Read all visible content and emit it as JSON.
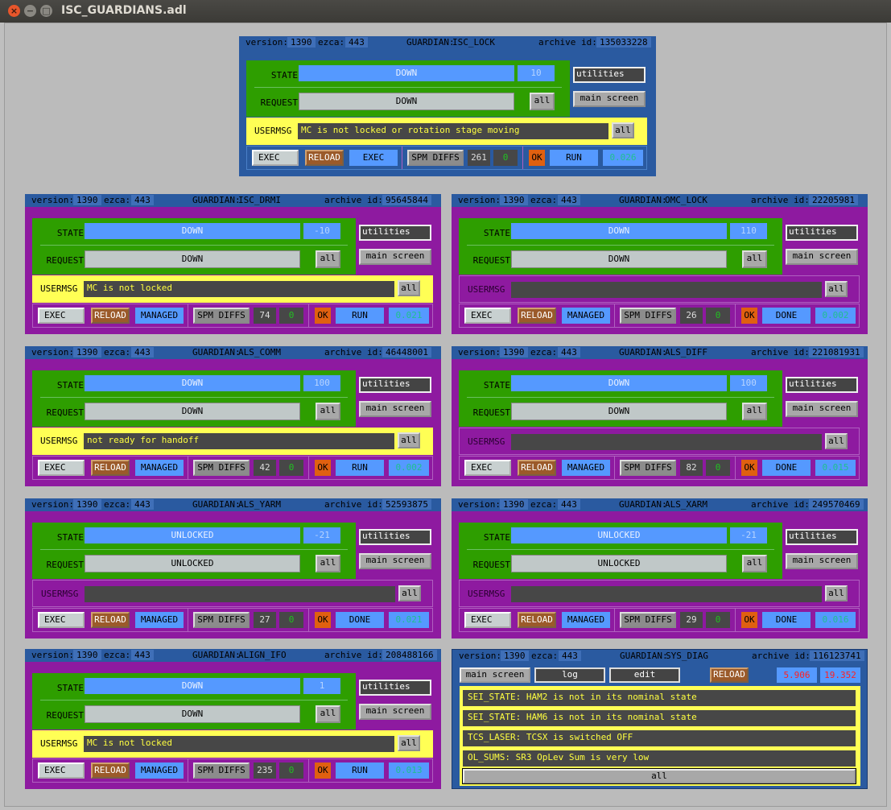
{
  "window": {
    "title": "ISC_GUARDIANS.adl",
    "close": "×",
    "minimize": "−",
    "maximize": "□"
  },
  "labels": {
    "version": "version:",
    "ezca": "ezca:",
    "guardian": "GUARDIAN:",
    "archive": "archive id:",
    "state": "STATE",
    "request": "REQUEST",
    "usermsg": "USERMSG",
    "all": "all",
    "utilities": "utilities",
    "main_screen": "main screen",
    "exec": "EXEC",
    "reload": "RELOAD",
    "spm_diffs": "SPM DIFFS",
    "ok": "OK",
    "managed": "MANAGED"
  },
  "panels": [
    {
      "name": "ISC_LOCK",
      "version": "1390",
      "ezca": "443",
      "archive_id": "135033228",
      "state": "DOWN",
      "state_num": "10",
      "request": "DOWN",
      "usermsg": "MC is not locked or rotation stage moving",
      "exec_mode": "EXEC",
      "spm": "261",
      "spm0": "0",
      "status": "RUN",
      "time": "0.026",
      "yellow": true
    },
    {
      "name": "ISC_DRMI",
      "version": "1390",
      "ezca": "443",
      "archive_id": "95645844",
      "state": "DOWN",
      "state_num": "-10",
      "request": "DOWN",
      "usermsg": "MC is not locked",
      "exec_mode": "MANAGED",
      "spm": "74",
      "spm0": "0",
      "status": "RUN",
      "time": "0.021",
      "yellow": true
    },
    {
      "name": "OMC_LOCK",
      "version": "1390",
      "ezca": "443",
      "archive_id": "22205981",
      "state": "DOWN",
      "state_num": "110",
      "request": "DOWN",
      "usermsg": "",
      "exec_mode": "MANAGED",
      "spm": "26",
      "spm0": "0",
      "status": "DONE",
      "time": "0.002",
      "yellow": false
    },
    {
      "name": "ALS_COMM",
      "version": "1390",
      "ezca": "443",
      "archive_id": "46448001",
      "state": "DOWN",
      "state_num": "100",
      "request": "DOWN",
      "usermsg": "not ready for handoff",
      "exec_mode": "MANAGED",
      "spm": "42",
      "spm0": "0",
      "status": "RUN",
      "time": "0.002",
      "yellow": true
    },
    {
      "name": "ALS_DIFF",
      "version": "1390",
      "ezca": "443",
      "archive_id": "221081931",
      "state": "DOWN",
      "state_num": "100",
      "request": "DOWN",
      "usermsg": "",
      "exec_mode": "MANAGED",
      "spm": "82",
      "spm0": "0",
      "status": "DONE",
      "time": "0.015",
      "yellow": false
    },
    {
      "name": "ALS_YARM",
      "version": "1390",
      "ezca": "443",
      "archive_id": "52593875",
      "state": "UNLOCKED",
      "state_num": "-21",
      "request": "UNLOCKED",
      "usermsg": "",
      "exec_mode": "MANAGED",
      "spm": "27",
      "spm0": "0",
      "status": "DONE",
      "time": "0.021",
      "yellow": false
    },
    {
      "name": "ALS_XARM",
      "version": "1390",
      "ezca": "443",
      "archive_id": "249570469",
      "state": "UNLOCKED",
      "state_num": "-21",
      "request": "UNLOCKED",
      "usermsg": "",
      "exec_mode": "MANAGED",
      "spm": "29",
      "spm0": "0",
      "status": "DONE",
      "time": "0.016",
      "yellow": false
    },
    {
      "name": "ALIGN_IFO",
      "version": "1390",
      "ezca": "443",
      "archive_id": "208488166",
      "state": "DOWN",
      "state_num": "1",
      "request": "DOWN",
      "usermsg": "MC is not locked",
      "exec_mode": "MANAGED",
      "spm": "235",
      "spm0": "0",
      "status": "RUN",
      "time": "0.013",
      "yellow": true
    }
  ],
  "sys_diag": {
    "name": "SYS_DIAG",
    "version": "1390",
    "ezca": "443",
    "archive_id": "116123741",
    "main_screen": "main screen",
    "log": "log",
    "edit": "edit",
    "reload": "RELOAD",
    "num_a": "5.906",
    "num_b": "19.352",
    "messages": [
      "SEI_STATE: HAM2 is not in its nominal state",
      "SEI_STATE: HAM6 is not in its nominal state",
      "TCS_LASER: TCSX is switched OFF",
      "OL_SUMS: SR3 OpLev Sum is very low"
    ],
    "all": "all"
  }
}
